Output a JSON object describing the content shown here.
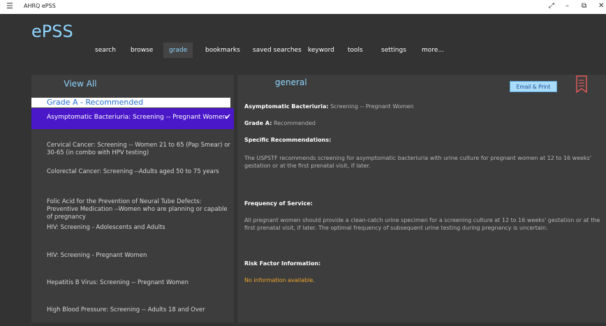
{
  "window": {
    "title": "AHRQ ePSS",
    "menu_icon": "hamburger-icon",
    "controls": [
      "expand-icon",
      "minimize-icon",
      "maximize-icon",
      "close-icon"
    ]
  },
  "header": {
    "brand": "ePSS",
    "nav": [
      {
        "label": "search"
      },
      {
        "label": "browse"
      },
      {
        "label": "grade",
        "active": true
      },
      {
        "label": "bookmarks"
      },
      {
        "label": "saved searches"
      },
      {
        "label": "keyword"
      },
      {
        "label": "tools"
      },
      {
        "label": "settings"
      },
      {
        "label": "more..."
      }
    ]
  },
  "left": {
    "view_all": "View All",
    "grade_header": "Grade A - Recommended",
    "selected": "Asymptomatic Bacteriuria: Screening -- Pregnant Women",
    "topics": [
      "Cervical Cancer: Screening -- Women 21 to 65 (Pap Smear) or 30-65 (in combo with HPV testing)",
      "Colorectal Cancer: Screening --Adults aged 50 to 75 years",
      "Folic Acid for the Prevention of Neural Tube Defects: Preventive Medication --Women who are planning or capable of pregnancy",
      "HIV: Screening - Adolescents and Adults",
      "HIV: Screening - Pregnant Women",
      "Hepatitis B Virus: Screening -- Pregnant Women",
      "High Blood Pressure: Screening -- Adults 18 and Over"
    ]
  },
  "right": {
    "tab_title": "general",
    "email_print": "Email & Print",
    "bookmark_icon": "bookmark-icon",
    "topic_label": "Asymptomatic Bacteriuria:",
    "topic_value": "Screening -- Pregnant Women",
    "grade_label": "Grade A:",
    "grade_value": "Recommended",
    "specific_label": "Specific Recommendations:",
    "specific_text": "The USPSTF recommends screening for asymptomatic bacteriuria with urine culture for pregnant women at 12 to 16 weeks' gestation or at the first prenatal visit, if later.",
    "frequency_label": "Frequency of Service:",
    "frequency_text": "All pregnant women should provide a clean-catch urine specimen for a screening culture at 12 to 16 weeks' gestation or at the first prenatal visit, if later. The optimal frequency of subsequent urine testing during pregnancy is uncertain.",
    "risk_label": "Risk Factor Information:",
    "risk_text": "No information available."
  },
  "colors": {
    "background": "#333333",
    "accent": "#8fd6ff",
    "selected": "#4a18c9",
    "warning": "#f2a62b",
    "bookmark": "#e05a5a"
  }
}
